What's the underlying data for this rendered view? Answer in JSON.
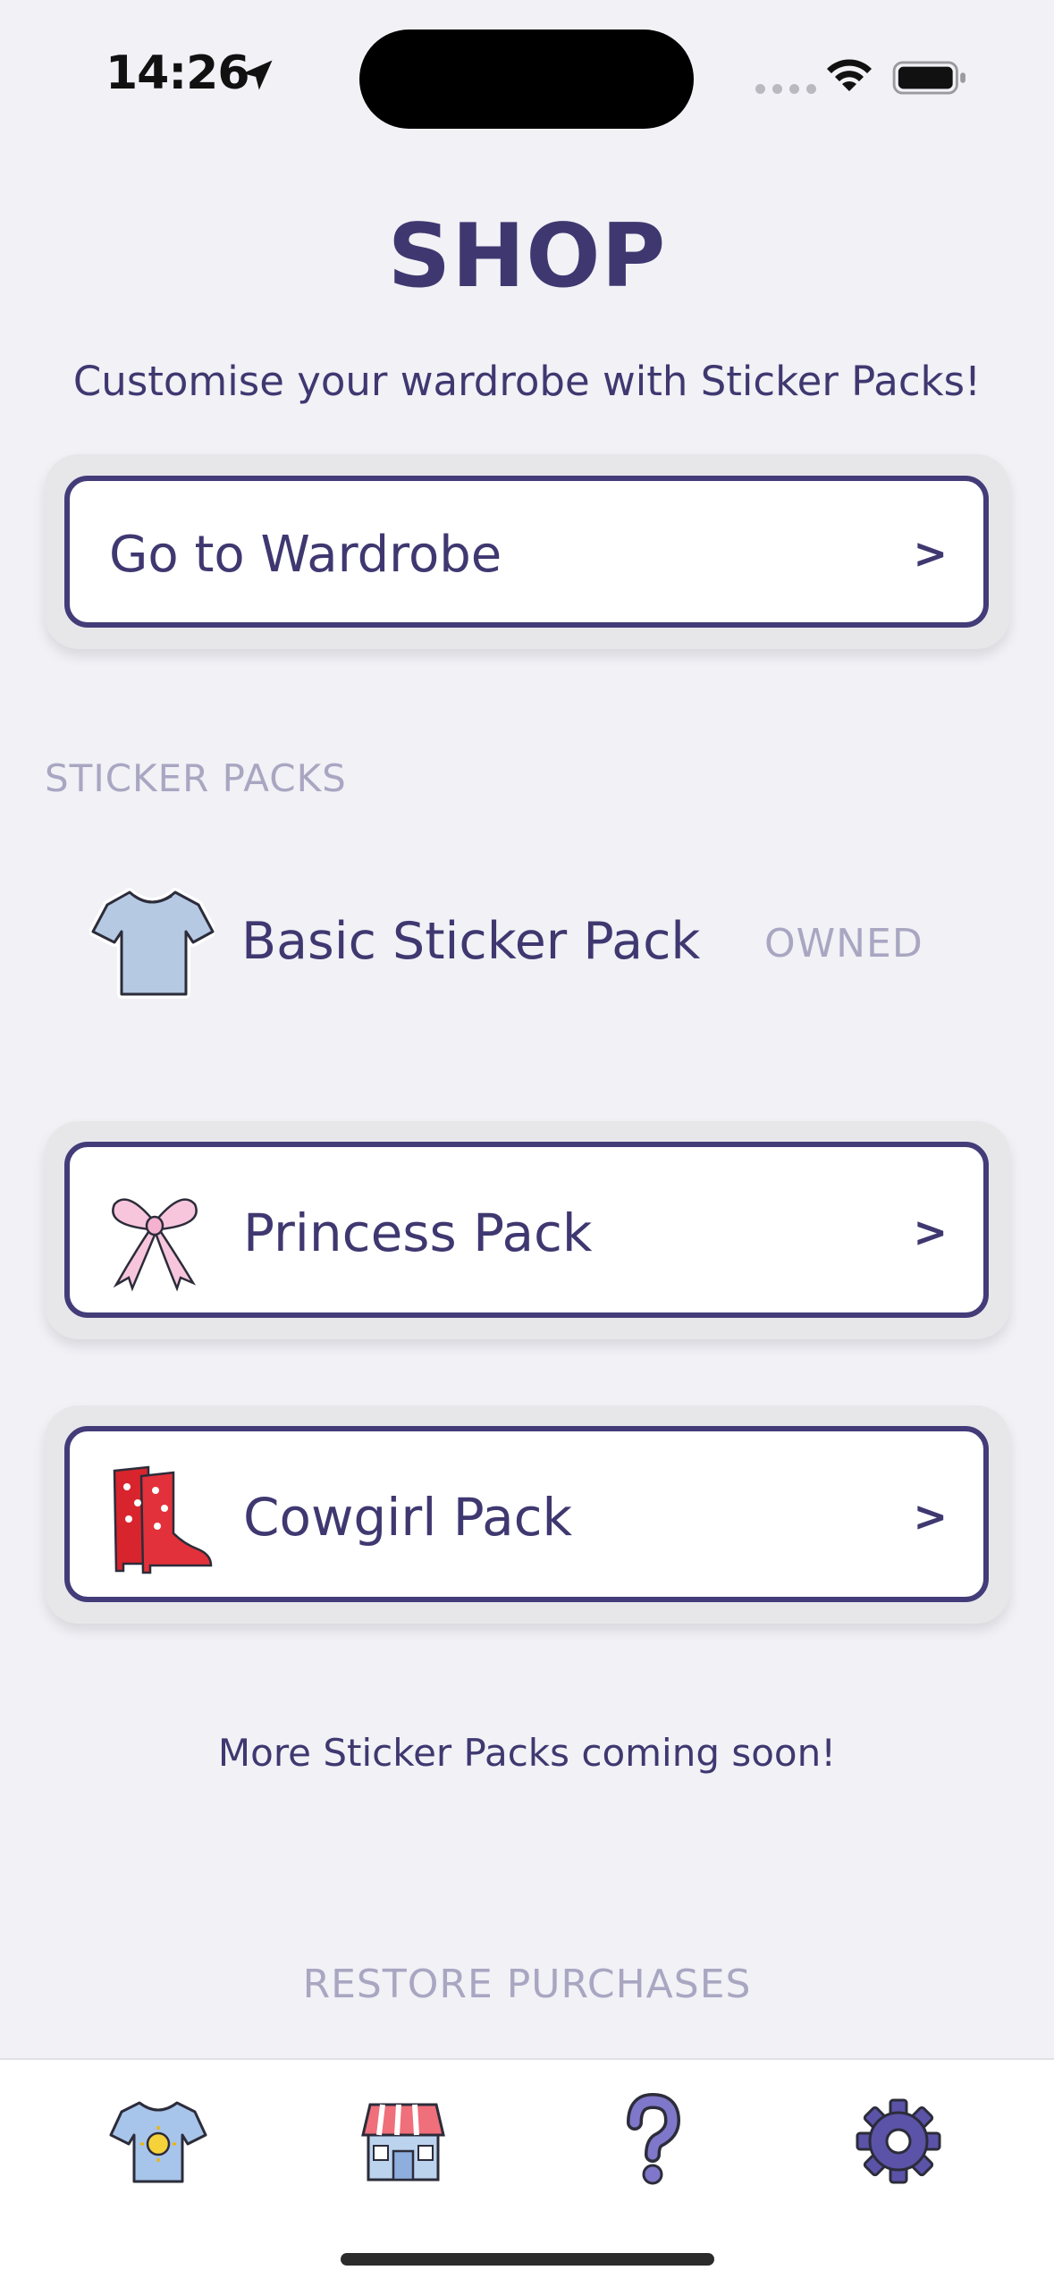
{
  "status_bar": {
    "time": "14:26"
  },
  "header": {
    "title": "SHOP",
    "subtitle": "Customise your wardrobe with Sticker Packs!"
  },
  "wardrobe_button": {
    "label": "Go to Wardrobe",
    "chevron": ">"
  },
  "sticker_packs": {
    "section_title": "STICKER PACKS",
    "basic": {
      "name": "Basic Sticker Pack",
      "status": "OWNED",
      "icon": "tshirt-icon"
    },
    "princess": {
      "name": "Princess Pack",
      "chevron": ">",
      "icon": "bow-icon"
    },
    "cowgirl": {
      "name": "Cowgirl Pack",
      "chevron": ">",
      "icon": "boots-icon"
    }
  },
  "footer": {
    "coming_soon": "More Sticker Packs coming soon!",
    "restore": "RESTORE PURCHASES"
  },
  "tabs": [
    {
      "icon": "sun-shirt-icon"
    },
    {
      "icon": "shop-icon"
    },
    {
      "icon": "help-icon"
    },
    {
      "icon": "settings-icon"
    }
  ],
  "colors": {
    "accent": "#433c79",
    "muted": "#a9a6c2",
    "background": "#f1f1f6"
  }
}
